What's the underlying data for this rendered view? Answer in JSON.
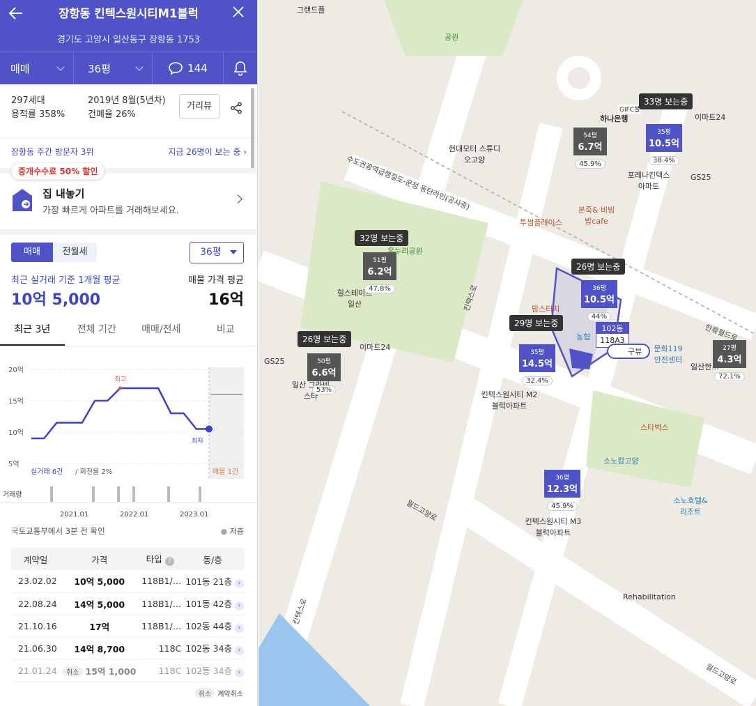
{
  "header": {
    "title": "장항동 킨텍스원시티M1블럭",
    "address": "경기도 고양시 일산동구 장항동 1753",
    "trade_type": "매매",
    "size": "36평",
    "comment_count": "144"
  },
  "info": {
    "households": "297세대",
    "built": "2019년 8월(5년차)",
    "floor_area_ratio": "용적률 358%",
    "coverage_ratio": "건폐율 26%",
    "street_view_label": "거리뷰"
  },
  "visitors": {
    "rank": "장항동 주간 방문자 3위",
    "viewing_now": "지금 26명이 보는 중"
  },
  "promo": {
    "badge": "중개수수료 50% 할인",
    "title": "집 내놓기",
    "subtitle": "가장 빠르게 아파트를 거래해보세요."
  },
  "price": {
    "seg_sale": "매매",
    "seg_rent": "전월세",
    "size_select": "36평",
    "recent_label": "최근 실거래 기준 1개월 평균",
    "recent_value": "10억 5,000",
    "listing_label": "매물 가격 평균",
    "listing_value": "16억"
  },
  "chart_tabs": [
    "최근 3년",
    "전체 기간",
    "매매/전세",
    "비교"
  ],
  "chart_data": {
    "type": "line",
    "x": [
      "2021.01",
      "2022.01",
      "2023.01"
    ],
    "ylim": [
      5,
      20
    ],
    "yticks": [
      "20억",
      "15억",
      "10억",
      "5억"
    ],
    "series": [
      {
        "values": [
          9,
          9,
          11.5,
          11.5,
          11.5,
          15,
          15,
          17,
          17,
          17,
          17,
          13,
          13,
          10.5,
          10.5
        ]
      }
    ],
    "high_label": "최고",
    "low_label": "최저",
    "note_left": "실거래 6건",
    "note_mid": "/ 회전율 2%",
    "note_right": "매물 1건",
    "volume_label": "거래량"
  },
  "table": {
    "source_note": "국토교통부에서 3분 전 확인",
    "low_label": "저층",
    "headers": [
      "계약일",
      "가격",
      "타입",
      "동/층"
    ],
    "rows": [
      {
        "date": "23.02.02",
        "price": "10억 5,000",
        "type": "118B1/…",
        "floor": "101동 21층"
      },
      {
        "date": "22.08.24",
        "price": "14억 5,000",
        "type": "118B1/…",
        "floor": "101동 42층"
      },
      {
        "date": "21.10.16",
        "price": "17억",
        "type": "118B1/…",
        "floor": "102동 44층"
      },
      {
        "date": "21.06.30",
        "price": "14억 8,700",
        "type": "118C",
        "floor": "102동 34층"
      },
      {
        "date": "21.01.24",
        "price": "15억 1,000",
        "type": "118C",
        "floor": "102동 34층",
        "cancel": "취소"
      }
    ],
    "legend_tag": "취소",
    "legend_text": "계약취소"
  },
  "map": {
    "pills": [
      "33명 보는중",
      "32명 보는중",
      "26명 보는중",
      "26명 보는중",
      "29명 보는중"
    ],
    "places": [
      "하나은행",
      "현대모터 스튜디오고양",
      "포레나킨텍스 아파트",
      "이마트24",
      "GS25",
      "투썸플레이스",
      "본죽& 비빔밥cafe",
      "온누리공원",
      "힐스테이트 일산",
      "이마트24",
      "GS25",
      "일산 그라비스타",
      "킨텍스원시티 M2블럭아파트",
      "킨텍스원시티 M3블럭아파트",
      "스타벅스",
      "소노캄고양",
      "소노호텔& 리조트",
      "문화119 안전센터",
      "Rehabilitation",
      "일산한...",
      "농협",
      "맘스터치",
      "공원",
      "그랜드플"
    ],
    "roads": [
      "수도권광역급행철도-운정 동탄라인(공사중)",
      "킨텍스로",
      "월드고양로",
      "한류월드로",
      "킨텍스로",
      "월드고양로"
    ],
    "markers": [
      {
        "size": "54평",
        "price": "6.7억",
        "pct": "45.9%"
      },
      {
        "size": "35평",
        "price": "10.5억",
        "pct": "38.4%"
      },
      {
        "size": "51평",
        "price": "6.2억",
        "pct": "47.8%"
      },
      {
        "size": "36평",
        "price": "10.5억",
        "pct": "44%"
      },
      {
        "size": "50평",
        "price": "6.6억",
        "pct": "53%"
      },
      {
        "size": "35평",
        "price": "14.5억",
        "pct": "32.4%"
      },
      {
        "size": "36평",
        "price": "12.3억",
        "pct": "45.9%"
      },
      {
        "size": "27평",
        "price": "4.3억",
        "pct": "72.1%"
      }
    ],
    "building_label": "102동",
    "building_type": "118A3",
    "gifc": "GIFC볼",
    "view_label": "구뷰"
  }
}
